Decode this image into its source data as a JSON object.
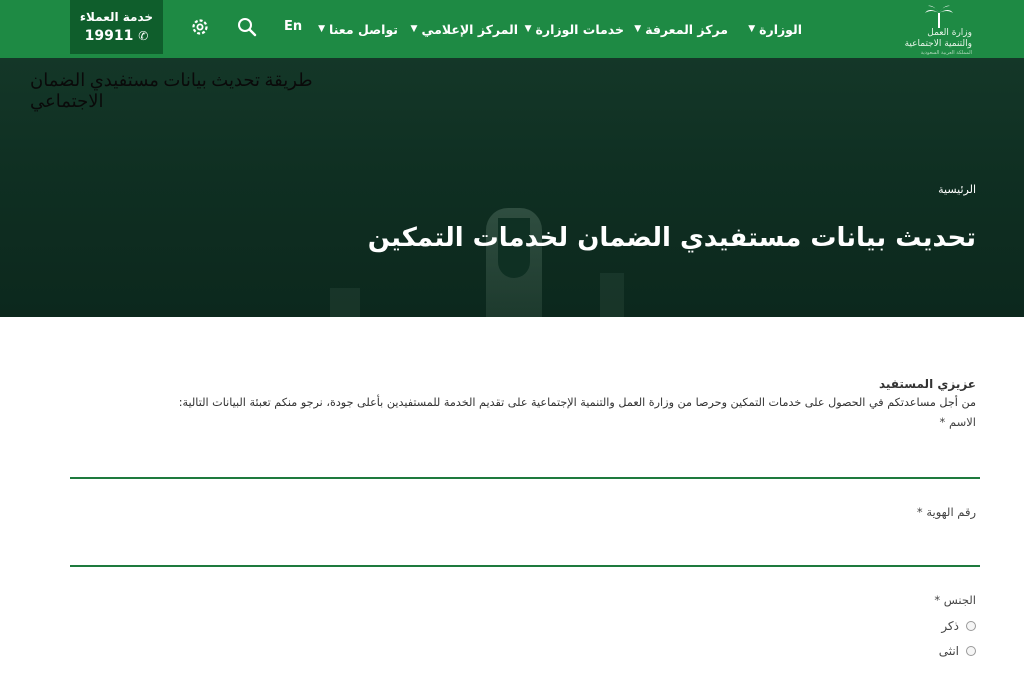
{
  "header": {
    "logo": {
      "line1": "وزارة العمل",
      "line2": "والتنمية الاجتماعية",
      "line3": "المملكة العربية السعودية"
    },
    "nav": [
      {
        "label": "الوزارة"
      },
      {
        "label": "مركز المعرفة"
      },
      {
        "label": "خدمات الوزارة"
      },
      {
        "label": "المركز الإعلامي"
      },
      {
        "label": "تواصل معنا"
      }
    ],
    "language_label": "En",
    "customer_service": {
      "title": "خدمة العملاء",
      "number": "19911"
    }
  },
  "overlay_caption": "طريقة تحديث بيانات مستفيدي الضمان الاجتماعي",
  "hero": {
    "breadcrumb": "الرئيسية",
    "title": "تحديث بيانات مستفيدي الضمان لخدمات التمكين"
  },
  "form": {
    "greeting": "عزيزي المستفيد",
    "intro": "من أجل مساعدتكم في الحصول على خدمات التمكين وحرصا من وزارة العمل والتنمية الإجتماعية على تقديم الخدمة للمستفيدين بأعلى جودة، نرجو منكم تعبئة البيانات التالية:",
    "name_label": "الاسم *",
    "name_value": "",
    "id_label": "رقم الهوية *",
    "id_value": "",
    "gender_label": "الجنس *",
    "gender_options": [
      "ذكر",
      "انثى"
    ]
  },
  "colors": {
    "header_green": "#1e8a44",
    "service_green": "#0f5e2c",
    "hero_dark": "#143728",
    "field_underline": "#1e7a3e"
  }
}
